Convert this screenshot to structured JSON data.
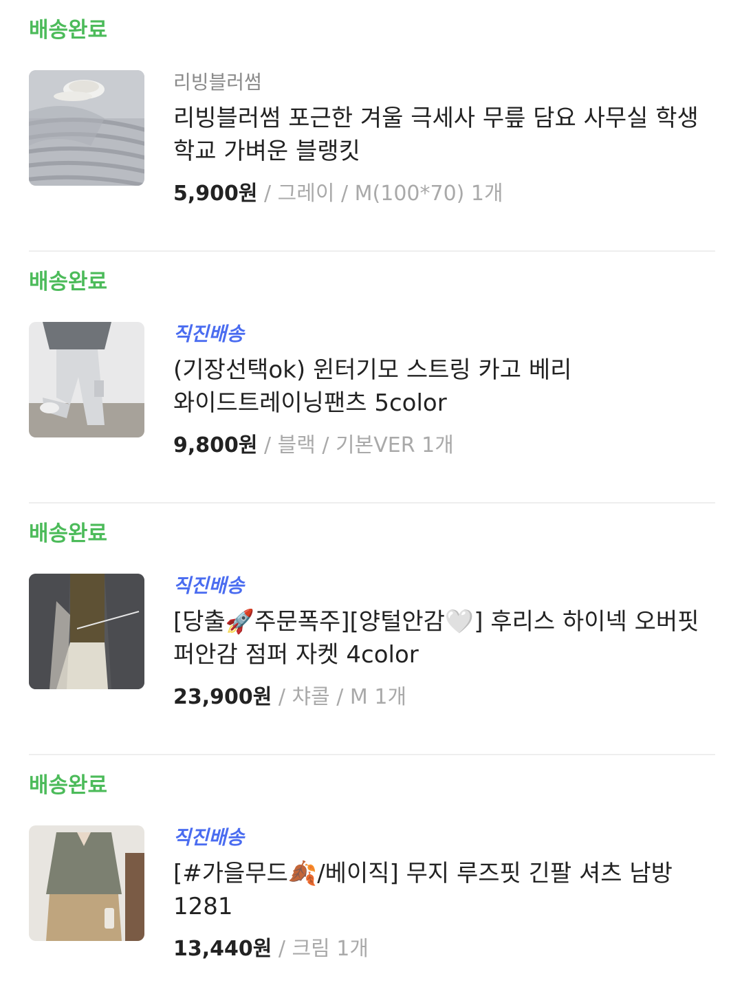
{
  "orders": [
    {
      "status": "배송완료",
      "brand": "리빙블러썸",
      "brand_is_badge": false,
      "title": "리빙블러썸 포근한 겨울 극세사 무릎 담요 사무실 학생 학교 가벼운 블랭킷",
      "price": "5,900원",
      "options": " / 그레이 / M(100*70) 1개",
      "thumbnail": "gray-fleece-blanket-photo"
    },
    {
      "status": "배송완료",
      "brand": "직진배송",
      "brand_is_badge": true,
      "title": "(기장선택ok) 윈터기모 스트링 카고 베리 와이드트레이닝팬츠 5color",
      "price": "9,800원",
      "options": " / 블랙 / 기본VER 1개",
      "thumbnail": "gray-cargo-pants-photo"
    },
    {
      "status": "배송완료",
      "brand": "직진배송",
      "brand_is_badge": true,
      "title": "[당출🚀주문폭주][양털안감🤍] 후리스 하이넥 오버핏 퍼안감 점퍼 자켓 4color",
      "price": "23,900원",
      "options": " / 챠콜 / M 1개",
      "thumbnail": "charcoal-fleece-jacket-photo"
    },
    {
      "status": "배송완료",
      "brand": "직진배송",
      "brand_is_badge": true,
      "title": "[#가을무드🍂/베이직] 무지 루즈핏 긴팔 셔츠 남방 1281",
      "price": "13,440원",
      "options": " / 크림 1개",
      "thumbnail": "khaki-shirt-photo"
    }
  ],
  "colors": {
    "status_green": "#4cbb5a",
    "badge_blue": "#4a6cf0",
    "options_gray": "#a9a9a9",
    "divider": "#eeeeee"
  }
}
